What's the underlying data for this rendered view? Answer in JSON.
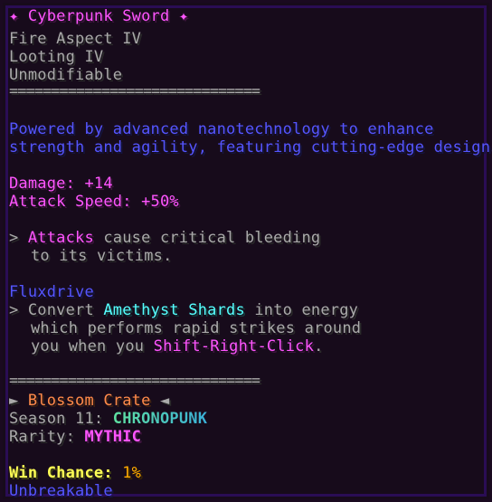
{
  "title": {
    "left_icon": "✦",
    "name": "Cyberpunk Sword",
    "right_icon": "✦"
  },
  "enchants": [
    "Fire Aspect IV",
    "Looting IV"
  ],
  "unmodifiable": "Unmodifiable",
  "separator": "==============================",
  "lore": [
    "Powered by advanced nanotechnology to enhance",
    "strength and agility, featuring cutting-edge designs."
  ],
  "stats": {
    "damage_label": "Damage:",
    "damage_value": "+14",
    "speed_label": "Attack Speed:",
    "speed_value": "+50%"
  },
  "passive": {
    "arrow": ">",
    "keyword": "Attacks",
    "text1": "cause critical bleeding",
    "text2": "to its victims."
  },
  "ability": {
    "name": "Fluxdrive",
    "arrow": ">",
    "pre": "Convert",
    "item": "Amethyst Shards",
    "post": "into energy",
    "line2": "which performs rapid strikes around",
    "line3_pre": "you when you",
    "keybind": "Shift-Right-Click",
    "line3_post": "."
  },
  "crate": {
    "left_icon": "►",
    "name": "Blossom Crate",
    "right_icon": "◄"
  },
  "season": {
    "label": "Season 11:",
    "value": "CHRONOPUNK"
  },
  "rarity": {
    "label": "Rarity:",
    "value": "MYTHIC"
  },
  "win_chance": {
    "label": "Win Chance:",
    "value": "1%"
  },
  "unbreakable": "Unbreakable",
  "colors": {
    "background": "#170b1b",
    "border": "#2a0d55",
    "pink": "#ff55ff",
    "gray": "#aaaaaa",
    "blue": "#5555ff",
    "aqua": "#55ffff",
    "orange": "#ff8a4a",
    "yellow": "#ffff55",
    "gold": "#ffaa00"
  }
}
